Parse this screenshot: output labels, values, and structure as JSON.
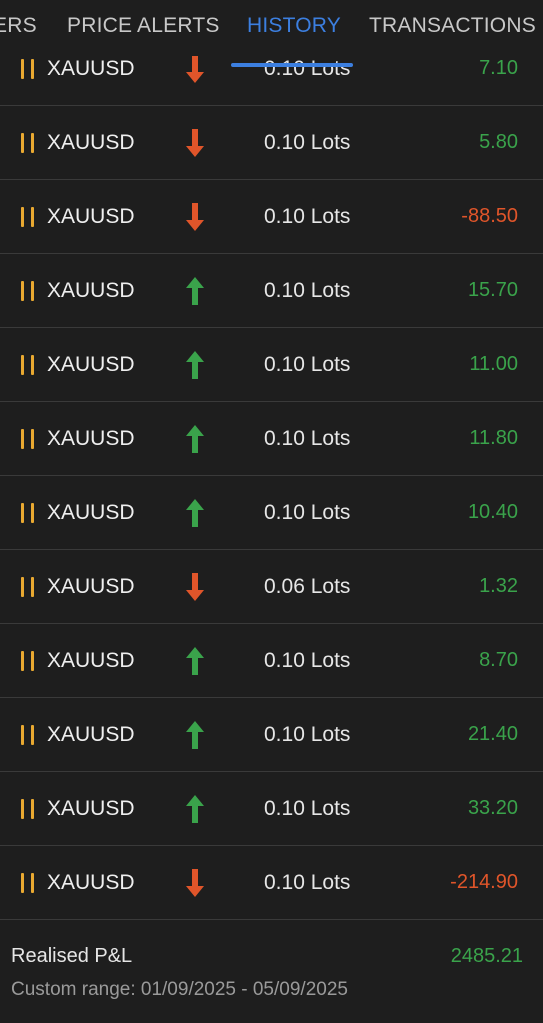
{
  "tabs": [
    {
      "label": "ERS",
      "active": false
    },
    {
      "label": "PRICE ALERTS",
      "active": false
    },
    {
      "label": "HISTORY",
      "active": true
    },
    {
      "label": "TRANSACTIONS",
      "active": false
    }
  ],
  "colors": {
    "accent": "#3c7fe0",
    "profit": "#3aa34b",
    "loss": "#e0552a",
    "pause": "#e9a931"
  },
  "trades": [
    {
      "symbol": "XAUUSD",
      "direction": "down",
      "lots": "0.10 Lots",
      "pnl": "7.10"
    },
    {
      "symbol": "XAUUSD",
      "direction": "down",
      "lots": "0.10 Lots",
      "pnl": "5.80"
    },
    {
      "symbol": "XAUUSD",
      "direction": "down",
      "lots": "0.10 Lots",
      "pnl": "-88.50"
    },
    {
      "symbol": "XAUUSD",
      "direction": "up",
      "lots": "0.10 Lots",
      "pnl": "15.70"
    },
    {
      "symbol": "XAUUSD",
      "direction": "up",
      "lots": "0.10 Lots",
      "pnl": "11.00"
    },
    {
      "symbol": "XAUUSD",
      "direction": "up",
      "lots": "0.10 Lots",
      "pnl": "11.80"
    },
    {
      "symbol": "XAUUSD",
      "direction": "up",
      "lots": "0.10 Lots",
      "pnl": "10.40"
    },
    {
      "symbol": "XAUUSD",
      "direction": "down",
      "lots": "0.06 Lots",
      "pnl": "1.32"
    },
    {
      "symbol": "XAUUSD",
      "direction": "up",
      "lots": "0.10 Lots",
      "pnl": "8.70"
    },
    {
      "symbol": "XAUUSD",
      "direction": "up",
      "lots": "0.10 Lots",
      "pnl": "21.40"
    },
    {
      "symbol": "XAUUSD",
      "direction": "up",
      "lots": "0.10 Lots",
      "pnl": "33.20"
    },
    {
      "symbol": "XAUUSD",
      "direction": "down",
      "lots": "0.10 Lots",
      "pnl": "-214.90"
    }
  ],
  "summary": {
    "realised_label": "Realised P&L",
    "realised_value": "2485.21",
    "range": "Custom range: 01/09/2025 - 05/09/2025"
  }
}
